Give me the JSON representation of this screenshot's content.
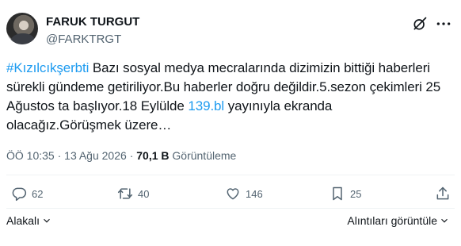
{
  "author": {
    "display_name": "FARUK TURGUT",
    "handle": "@FARKTRGT"
  },
  "tweet": {
    "hashtag": "#Kızılcıkşerbti",
    "text_part1": " Bazı sosyal medya mecralarında dizimizin bittiği haberleri sürekli gündeme getiriliyor.Bu haberler doğru değildir.5.sezon çekimleri 25 Ağustos ta başlıyor.18 Eylülde ",
    "link": "139.bl",
    "text_part2": " yayınıyla ekranda olacağız.Görüşmek üzere…"
  },
  "meta": {
    "time": "ÖÖ 10:35",
    "separator": "·",
    "date": "13 Ağu 2026",
    "views_count": "70,1 B",
    "views_label": "Görüntüleme"
  },
  "actions": {
    "replies": "62",
    "reposts": "40",
    "likes": "146",
    "bookmarks": "25"
  },
  "footer": {
    "related_label": "Alakalı",
    "quotes_label": "Alıntıları görüntüle"
  },
  "icons": [
    "grok-icon",
    "more-icon",
    "reply-icon",
    "repost-icon",
    "like-icon",
    "bookmark-icon",
    "share-icon",
    "chevron-down-icon"
  ],
  "colors": {
    "text": "#0f1419",
    "secondary": "#536471",
    "link": "#1d9bf0",
    "divider": "#eff3f4"
  }
}
